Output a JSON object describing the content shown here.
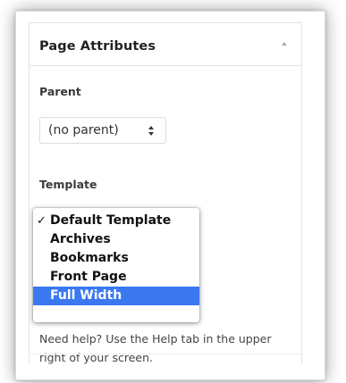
{
  "panel": {
    "title": "Page Attributes",
    "toggle_icon": "caret-up-icon"
  },
  "parent": {
    "label": "Parent",
    "selected_value": "(no parent)",
    "stepper_icon": "select-stepper-icon"
  },
  "template": {
    "label": "Template",
    "options": [
      {
        "label": "Default Template",
        "checked": true,
        "highlighted": false
      },
      {
        "label": "Archives",
        "checked": false,
        "highlighted": false
      },
      {
        "label": "Bookmarks",
        "checked": false,
        "highlighted": false
      },
      {
        "label": "Front Page",
        "checked": false,
        "highlighted": false
      },
      {
        "label": "Full Width",
        "checked": false,
        "highlighted": true
      }
    ],
    "check_glyph": "✓"
  },
  "help": {
    "text": "Need help? Use the Help tab in the upper right of your screen."
  },
  "colors": {
    "highlight": "#3b78f0",
    "title_text": "#222222",
    "body_text": "#444444"
  }
}
